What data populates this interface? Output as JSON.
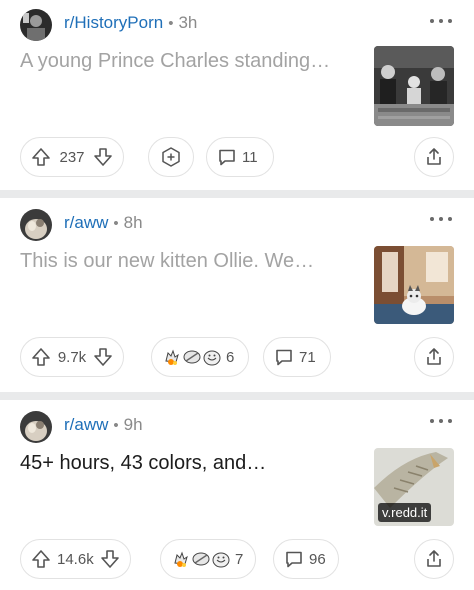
{
  "colors": {
    "accent": "#1f6fb8",
    "read_title": "#a3a3a3",
    "divider": "#e9eaeb"
  },
  "posts": [
    {
      "subreddit": "r/HistoryPorn",
      "separator": "•",
      "age": "3h",
      "title": "A young Prince Charles standing…",
      "votes": "237",
      "comments": "11",
      "award_icon": "award-plus-icon"
    },
    {
      "subreddit": "r/aww",
      "separator": "•",
      "age": "8h",
      "title": "This is our new kitten Ollie. We…",
      "votes": "9.7k",
      "awards_count": "6",
      "comments": "71"
    },
    {
      "subreddit": "r/aww",
      "separator": "•",
      "age": "9h",
      "title": "45+ hours, 43 colors, and…",
      "votes": "14.6k",
      "awards_count": "7",
      "comments": "96",
      "thumbnail_domain": "v.redd.it"
    }
  ]
}
